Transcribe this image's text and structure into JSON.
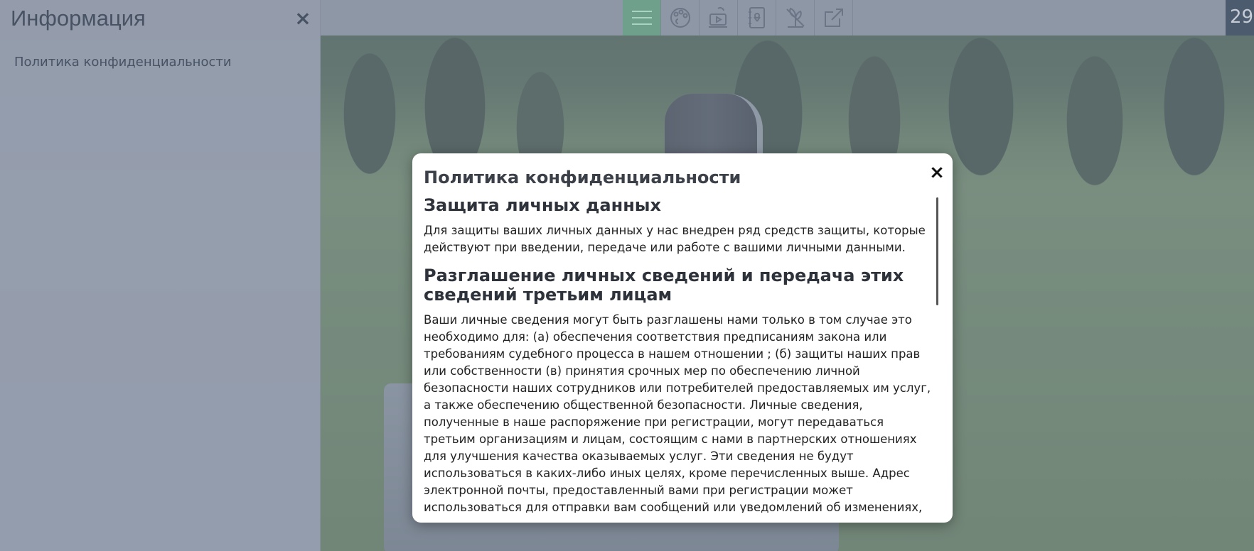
{
  "panel": {
    "title": "Информация",
    "close_icon": "close-icon",
    "link": "Политика конфиденциальности"
  },
  "toolbar": {
    "buttons": [
      {
        "icon": "menu-icon",
        "active": true
      },
      {
        "icon": "palette-icon",
        "active": false
      },
      {
        "icon": "video-icon",
        "active": false
      },
      {
        "icon": "map-book-icon",
        "active": false
      },
      {
        "icon": "plants-icon",
        "active": false
      },
      {
        "icon": "share-icon",
        "active": false
      }
    ],
    "counter": "29"
  },
  "modal": {
    "title": "Политика конфиденциальности",
    "sections": [
      {
        "heading": "Защита личных данных",
        "text": "Для защиты ваших личных данных у нас внедрен ряд средств защиты, которые действуют при введении, передаче или работе с вашими личными данными."
      },
      {
        "heading": "Разглашение личных сведений и передача этих сведений третьим лицам",
        "text": "Ваши личные сведения могут быть разглашены нами только в том случае это необходимо для: (а) обеспечения соответствия предписаниям закона или требованиям судебного процесса в нашем отношении ; (б) защиты наших прав или собственности (в) принятия срочных мер по обеспечению личной безопасности наших сотрудников или потребителей предоставляемых им услуг, а также обеспечению общественной безопасности. Личные сведения, полученные в наше распоряжение при регистрации, могут передаваться третьим организациям и лицам, состоящим с нами в партнерских отношениях для улучшения качества оказываемых услуг. Эти сведения не будут использоваться в каких-либо иных целях, кроме перечисленных выше. Адрес электронной почты, предоставленный вами при регистрации может использоваться для отправки вам сообщений или уведомлений об изменениях, связанных с вашей заявкой, а также рассылки сообщений о"
      }
    ]
  },
  "colors": {
    "accent": "#6fa08c",
    "panel_bg": "#969eaf",
    "counter_bg": "#4c5b6e"
  }
}
